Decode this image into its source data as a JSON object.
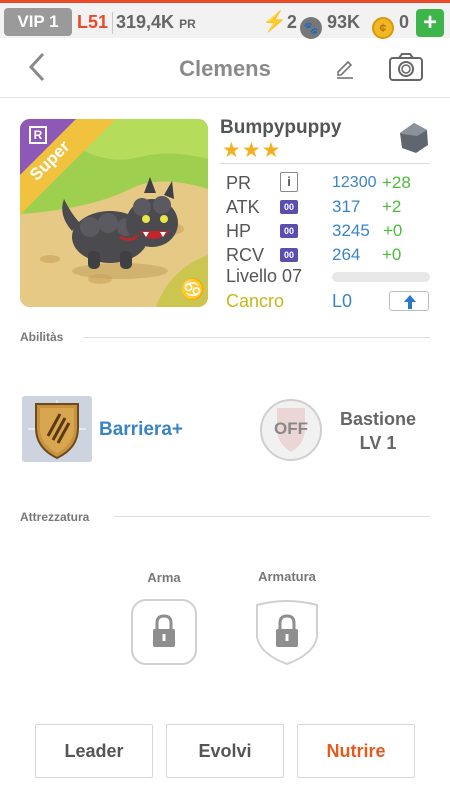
{
  "status": {
    "vip": "VIP 1",
    "level": "L51",
    "power_value": "319,4K",
    "power_unit": "PR",
    "energy": "2",
    "paws": "93K",
    "coins": "0",
    "add_label": "+"
  },
  "header": {
    "back_icon": "chevron-left-icon",
    "title": "Clemens",
    "edit_icon": "pencil-icon",
    "camera_icon": "camera-icon"
  },
  "pet": {
    "name": "Bumpypuppy",
    "stars": "★★★",
    "star_count": 3,
    "rarity_badge": "R",
    "ribbon": "Super",
    "zodiac_symbol": "♋",
    "element_icon": "rock-element-icon",
    "stats": [
      {
        "label": "PR",
        "icon": "i",
        "value": "12300",
        "bonus": "+28"
      },
      {
        "label": "ATK",
        "icon": "00",
        "value": "317",
        "bonus": "+2"
      },
      {
        "label": "HP",
        "icon": "00",
        "value": "3245",
        "bonus": "+0"
      },
      {
        "label": "RCV",
        "icon": "00",
        "value": "264",
        "bonus": "+0"
      }
    ],
    "level_label": "Livello 07",
    "sign_label": "Cancro",
    "limit_level": "L0",
    "colors": {
      "stat_value": "#3a84c6",
      "bonus": "#4cbb3a",
      "sign": "#c9b51a"
    }
  },
  "abilities": {
    "section_title": "Abilitàs",
    "active": {
      "name": "Barriera+",
      "icon": "shield-claw-icon"
    },
    "passive": {
      "badge": "OFF",
      "name": "Bastione",
      "level": "LV 1",
      "icon": "shield-off-icon"
    }
  },
  "equipment": {
    "section_title": "Attrezzatura",
    "slots": [
      {
        "label": "Arma",
        "icon": "lock-icon"
      },
      {
        "label": "Armatura",
        "icon": "lock-icon"
      }
    ]
  },
  "actions": {
    "leader": "Leader",
    "evolve": "Evolvi",
    "feed": "Nutrire",
    "accent": "#e85a1c"
  }
}
